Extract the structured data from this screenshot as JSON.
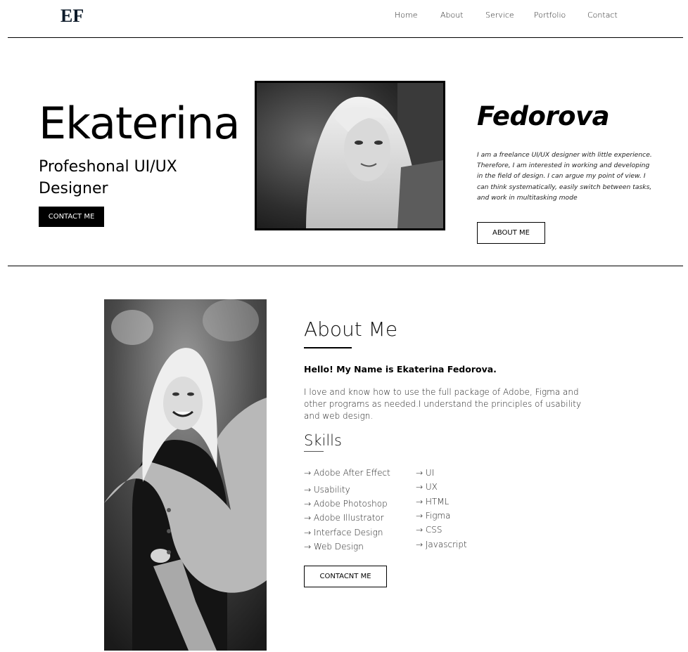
{
  "brand": {
    "logo_text": "EF"
  },
  "nav": {
    "items": [
      {
        "label": "Home"
      },
      {
        "label": "About"
      },
      {
        "label": "Service"
      },
      {
        "label": "Portfolio"
      },
      {
        "label": "Contact"
      }
    ]
  },
  "hero": {
    "first_name": "Ekaterina",
    "role": "Profeshonal UI/UX Designer",
    "contact_button": "CONTACT ME",
    "last_name": "Fedorova",
    "description": "I am a freelance UI/UX designer with little experience. Therefore, I am interested in working and developing in the field of design. I can argue my point of view. I can think systematically, easily switch between tasks, and work in multitasking mode",
    "about_button": "ABOUT ME"
  },
  "about": {
    "title": "About Me",
    "greeting": "Hello! My Name is Ekaterina Fedorova.",
    "body": "I love and know how to use the full package of Adobe, Figma and other programs as needed.I understand the principles of usability and web design.",
    "skills_title": "Skills",
    "skills_left": [
      "→ Adobe After Effect",
      "→ Usability",
      "→ Adobe Photoshop",
      "→ Adobe Illustrator",
      "→ Interface Design",
      "→ Web Design"
    ],
    "skills_right": [
      "→ UI",
      "→ UX",
      "→ HTML",
      "→ Figma",
      "→ CSS",
      "→ Javascript"
    ],
    "contact_button": "CONTACNT ME"
  }
}
